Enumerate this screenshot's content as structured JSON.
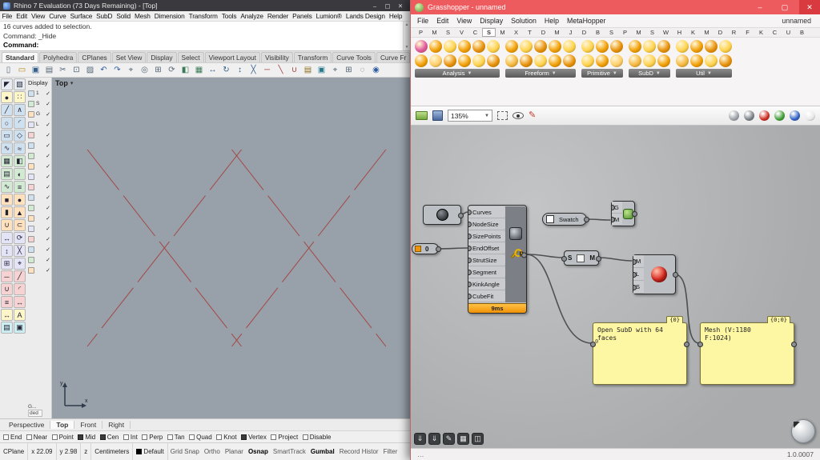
{
  "rhino": {
    "titlebar": {
      "title": "Rhino 7 Evaluation (73 Days Remaining) - [Top]"
    },
    "menu": [
      "File",
      "Edit",
      "View",
      "Curve",
      "Surface",
      "SubD",
      "Solid",
      "Mesh",
      "Dimension",
      "Transform",
      "Tools",
      "Analyze",
      "Render",
      "Panels",
      "Lumion®",
      "Lands Design",
      "Help"
    ],
    "command_history": [
      "16 curves added to selection.",
      "Command: _Hide"
    ],
    "command_prompt": "Command:",
    "toolbar_tabs": [
      {
        "label": "Standard",
        "selected": true
      },
      {
        "label": "Polyhedra"
      },
      {
        "label": "CPlanes"
      },
      {
        "label": "Set View"
      },
      {
        "label": "Display"
      },
      {
        "label": "Select"
      },
      {
        "label": "Viewport Layout"
      },
      {
        "label": "Visibility"
      },
      {
        "label": "Transform"
      },
      {
        "label": "Curve Tools"
      },
      {
        "label": "Curve Fr"
      }
    ],
    "toolbar_icons": [
      {
        "name": "new-file-icon",
        "g": "▯",
        "c": "#5a6a7a"
      },
      {
        "name": "open-file-icon",
        "g": "▭",
        "c": "#b8860b"
      },
      {
        "name": "save-icon",
        "g": "▣",
        "c": "#35608c"
      },
      {
        "name": "print-icon",
        "g": "▤",
        "c": "#556677"
      },
      {
        "name": "cut-icon",
        "g": "✂",
        "c": "#556677"
      },
      {
        "name": "copy-icon",
        "g": "⊡",
        "c": "#556677"
      },
      {
        "name": "paste-icon",
        "g": "▨",
        "c": "#556677"
      },
      {
        "name": "undo-icon",
        "g": "↶",
        "c": "#2e5c9e"
      },
      {
        "name": "redo-icon",
        "g": "↷",
        "c": "#2e5c9e"
      },
      {
        "name": "pan-icon",
        "g": "⌖",
        "c": "#556677"
      },
      {
        "name": "zoom-extents-icon",
        "g": "◎",
        "c": "#556677"
      },
      {
        "name": "zoom-window-icon",
        "g": "⊞",
        "c": "#556677"
      },
      {
        "name": "rotate-view-icon",
        "g": "⟳",
        "c": "#556677"
      },
      {
        "name": "shaded-view-icon",
        "g": "◧",
        "c": "#3b7a57"
      },
      {
        "name": "wireframe-view-icon",
        "g": "▦",
        "c": "#3b7a57"
      },
      {
        "name": "move-icon",
        "g": "↔",
        "c": "#35608c"
      },
      {
        "name": "rotate-icon",
        "g": "↻",
        "c": "#35608c"
      },
      {
        "name": "scale-icon",
        "g": "↕",
        "c": "#35608c"
      },
      {
        "name": "mirror-icon",
        "g": "╳",
        "c": "#35608c"
      },
      {
        "name": "trim-icon",
        "g": "─",
        "c": "#a23b3b"
      },
      {
        "name": "split-icon",
        "g": "╲",
        "c": "#a23b3b"
      },
      {
        "name": "join-icon",
        "g": "∪",
        "c": "#a23b3b"
      },
      {
        "name": "layers-icon",
        "g": "▤",
        "c": "#8a6d1a"
      },
      {
        "name": "properties-icon",
        "g": "▣",
        "c": "#2a7a8c"
      },
      {
        "name": "osnap-icon",
        "g": "⌖",
        "c": "#556677"
      },
      {
        "name": "grid-icon",
        "g": "⊞",
        "c": "#556677"
      },
      {
        "name": "hide-icon",
        "g": "◌",
        "c": "#556677"
      },
      {
        "name": "help-icon",
        "g": "◉",
        "c": "#2e5c9e"
      }
    ],
    "sidebar_icons": [
      {
        "name": "select-arrow-icon",
        "g": "◤",
        "c": "#e6ecf2"
      },
      {
        "name": "select-brush-icon",
        "g": "▧",
        "c": "#e6ecf2"
      },
      {
        "name": "point-icon",
        "g": "●",
        "c": "#fdf6c9"
      },
      {
        "name": "point-grid-icon",
        "g": "∷",
        "c": "#fdf6c9"
      },
      {
        "name": "line-icon",
        "g": "╱",
        "c": "#cfe0ef"
      },
      {
        "name": "polyline-icon",
        "g": "∧",
        "c": "#cfe0ef"
      },
      {
        "name": "circle-icon",
        "g": "○",
        "c": "#cfe0ef"
      },
      {
        "name": "arc-icon",
        "g": "◜",
        "c": "#cfe0ef"
      },
      {
        "name": "rectangle-icon",
        "g": "▭",
        "c": "#cfe0ef"
      },
      {
        "name": "polygon-icon",
        "g": "◇",
        "c": "#cfe0ef"
      },
      {
        "name": "freeform-curve-icon",
        "g": "∿",
        "c": "#cfe0ef"
      },
      {
        "name": "interpolate-curve-icon",
        "g": "≈",
        "c": "#cfe0ef"
      },
      {
        "name": "surface-plane-icon",
        "g": "▦",
        "c": "#d2ead2"
      },
      {
        "name": "surface-corner-icon",
        "g": "◧",
        "c": "#d2ead2"
      },
      {
        "name": "extrude-icon",
        "g": "▤",
        "c": "#d2ead2"
      },
      {
        "name": "revolve-icon",
        "g": "◐",
        "c": "#d2ead2"
      },
      {
        "name": "sweep-icon",
        "g": "∿",
        "c": "#d2ead2"
      },
      {
        "name": "loft-icon",
        "g": "≡",
        "c": "#d2ead2"
      },
      {
        "name": "box-icon",
        "g": "■",
        "c": "#ffe2bd"
      },
      {
        "name": "sphere-icon",
        "g": "●",
        "c": "#ffe2bd"
      },
      {
        "name": "cylinder-icon",
        "g": "▮",
        "c": "#ffe2bd"
      },
      {
        "name": "cone-icon",
        "g": "▲",
        "c": "#ffe2bd"
      },
      {
        "name": "boolean-union-icon",
        "g": "∪",
        "c": "#ffe2bd"
      },
      {
        "name": "boolean-difference-icon",
        "g": "⊂",
        "c": "#ffe2bd"
      },
      {
        "name": "move-tool-icon",
        "g": "↔",
        "c": "#e4e4f7"
      },
      {
        "name": "rotate-tool-icon",
        "g": "⟳",
        "c": "#e4e4f7"
      },
      {
        "name": "scale-tool-icon",
        "g": "↕",
        "c": "#e4e4f7"
      },
      {
        "name": "mirror-tool-icon",
        "g": "╳",
        "c": "#e4e4f7"
      },
      {
        "name": "array-icon",
        "g": "⊞",
        "c": "#e4e4f7"
      },
      {
        "name": "orient-icon",
        "g": "⌖",
        "c": "#e4e4f7"
      },
      {
        "name": "trim-tool-icon",
        "g": "─",
        "c": "#f7d2d2"
      },
      {
        "name": "split-tool-icon",
        "g": "╱",
        "c": "#f7d2d2"
      },
      {
        "name": "join-tool-icon",
        "g": "∪",
        "c": "#f7d2d2"
      },
      {
        "name": "fillet-icon",
        "g": "◜",
        "c": "#f7d2d2"
      },
      {
        "name": "offset-icon",
        "g": "≡",
        "c": "#f7d2d2"
      },
      {
        "name": "extend-icon",
        "g": "↔",
        "c": "#f7d2d2"
      },
      {
        "name": "dimension-icon",
        "g": "↔",
        "c": "#fdf6c9"
      },
      {
        "name": "text-icon",
        "g": "A",
        "c": "#fdf6c9"
      },
      {
        "name": "layer-icon",
        "g": "▤",
        "c": "#cdeef2"
      },
      {
        "name": "properties-panel-icon",
        "g": "▣",
        "c": "#cdeef2"
      }
    ],
    "display_panel": {
      "title": "Display",
      "rows": [
        {
          "label": "1",
          "checked": true,
          "c": "#cfe0ef"
        },
        {
          "label": "S",
          "checked": true,
          "c": "#d2ead2"
        },
        {
          "label": "G",
          "checked": true,
          "c": "#ffe2bd"
        },
        {
          "label": "L",
          "checked": true,
          "c": "#e4e4f7"
        },
        {
          "label": "",
          "checked": true,
          "c": "#f7d2d2"
        },
        {
          "label": "",
          "checked": true,
          "c": "#cfe0ef"
        },
        {
          "label": "",
          "checked": true,
          "c": "#d2ead2"
        },
        {
          "label": "",
          "checked": true,
          "c": "#ffe2bd"
        },
        {
          "label": "",
          "checked": true,
          "c": "#e4e4f7"
        },
        {
          "label": "",
          "checked": true,
          "c": "#f7d2d2"
        },
        {
          "label": "",
          "checked": true,
          "c": "#cfe0ef"
        },
        {
          "label": "",
          "checked": true,
          "c": "#d2ead2"
        },
        {
          "label": "",
          "checked": true,
          "c": "#ffe2bd"
        },
        {
          "label": "",
          "checked": true,
          "c": "#e4e4f7"
        },
        {
          "label": "",
          "checked": true,
          "c": "#f7d2d2"
        },
        {
          "label": "",
          "checked": true,
          "c": "#cfe0ef"
        },
        {
          "label": "",
          "checked": true,
          "c": "#d2ead2"
        },
        {
          "label": "",
          "checked": true,
          "c": "#ffe2bd"
        }
      ],
      "fragment1": "G...",
      "fragment2": "ded"
    },
    "viewport": {
      "label": "Top",
      "axis_x": "x",
      "axis_y": "y"
    },
    "viewport_tabs": [
      {
        "label": "Perspective"
      },
      {
        "label": "Top",
        "selected": true
      },
      {
        "label": "Front"
      },
      {
        "label": "Right"
      }
    ],
    "osnap": [
      {
        "label": "End"
      },
      {
        "label": "Near"
      },
      {
        "label": "Point"
      },
      {
        "label": "Mid",
        "checked": true
      },
      {
        "label": "Cen",
        "checked": true
      },
      {
        "label": "Int"
      },
      {
        "label": "Perp"
      },
      {
        "label": "Tan"
      },
      {
        "label": "Quad"
      },
      {
        "label": "Knot"
      },
      {
        "label": "Vertex",
        "checked": true
      },
      {
        "label": "Project"
      },
      {
        "label": "Disable"
      }
    ],
    "status": {
      "cplane": "CPlane",
      "x": "x 22.09",
      "y": "y 2.98",
      "z": "z",
      "units": "Centimeters",
      "layer": "Default",
      "toggles": [
        {
          "label": "Grid Snap"
        },
        {
          "label": "Ortho"
        },
        {
          "label": "Planar"
        },
        {
          "label": "Osnap",
          "bold": true
        },
        {
          "label": "SmartTrack"
        },
        {
          "label": "Gumbal",
          "bold": true
        },
        {
          "label": "Record Histor"
        },
        {
          "label": "Filter"
        }
      ]
    }
  },
  "grasshopper": {
    "titlebar": {
      "title": "Grasshopper - unnamed"
    },
    "menu": [
      "File",
      "Edit",
      "View",
      "Display",
      "Solution",
      "Help",
      "MetaHopper"
    ],
    "doc_label": "unnamed",
    "tabs": [
      "P",
      "M",
      "S",
      "V",
      "C",
      {
        "label": "S",
        "selected": true
      },
      "M",
      "X",
      "T",
      "D",
      "M",
      "J",
      "D",
      "B",
      "S",
      "P",
      "M",
      "S",
      "W",
      "H",
      "K",
      "M",
      "D",
      "R",
      "F",
      "K",
      "C",
      "U",
      "B"
    ],
    "ribbon": {
      "analysis": {
        "label": "Analysis",
        "icons": [
          {
            "c": "#e059a0"
          },
          {
            "c": "#f2a007"
          },
          {
            "c": "#ffd34d"
          },
          {
            "c": "#f2a007"
          },
          {
            "c": "#e8920c"
          },
          {
            "c": "#ffd34d"
          },
          {
            "c": "#f2a007"
          },
          {
            "c": "#ffcf6b"
          },
          {
            "c": "#e8920c"
          },
          {
            "c": "#f2a007"
          },
          {
            "c": "#ffd34d"
          },
          {
            "c": "#e8920c"
          }
        ]
      },
      "freeform": {
        "label": "Freeform",
        "icons": [
          {
            "c": "#f2a007"
          },
          {
            "c": "#ffd34d"
          },
          {
            "c": "#e8920c"
          },
          {
            "c": "#f2a007"
          },
          {
            "c": "#ffd34d"
          },
          {
            "c": "#f5b942"
          },
          {
            "c": "#e8920c"
          },
          {
            "c": "#ffd34d"
          },
          {
            "c": "#f2a007"
          },
          {
            "c": "#e8920c"
          }
        ]
      },
      "primitive": {
        "label": "Primitive",
        "icons": [
          {
            "c": "#ffd34d"
          },
          {
            "c": "#f2a007"
          },
          {
            "c": "#e8920c"
          },
          {
            "c": "#ffd34d"
          },
          {
            "c": "#f2a007"
          },
          {
            "c": "#ffcf6b"
          }
        ]
      },
      "subd": {
        "label": "SubD",
        "icons": [
          {
            "c": "#f2a007"
          },
          {
            "c": "#ffd34d"
          },
          {
            "c": "#e8920c"
          },
          {
            "c": "#f5b942"
          },
          {
            "c": "#ffd34d"
          },
          {
            "c": "#f2a007"
          }
        ]
      },
      "util": {
        "label": "Util",
        "icons": [
          {
            "c": "#ffd34d"
          },
          {
            "c": "#f2a007"
          },
          {
            "c": "#e8920c"
          },
          {
            "c": "#ffd34d"
          },
          {
            "c": "#f5b942"
          },
          {
            "c": "#f2a007"
          },
          {
            "c": "#ffd34d"
          },
          {
            "c": "#e8920c"
          }
        ]
      }
    },
    "canvas_toolbar": {
      "zoom": "135%"
    },
    "display_balls": [
      {
        "c": "#9aa0a6"
      },
      {
        "c": "#7a8086"
      },
      {
        "c": "#cc2b1e"
      },
      {
        "c": "#3f9b35"
      },
      {
        "c": "#2f5fc4"
      },
      {
        "c": "#e8e8e8"
      }
    ],
    "nodes": {
      "slider": {
        "value": "0"
      },
      "comp": {
        "input_list": [
          "Curves",
          "NodeSize",
          "SizePoints",
          "EndOffset",
          "StrutSize",
          "Segment",
          "KinkAngle",
          "CubeFit"
        ],
        "output": "P",
        "time": "9ms"
      },
      "swatch": {
        "label": "Swatch"
      },
      "gm": {
        "input_list": [
          "G",
          "M"
        ]
      },
      "sm": {
        "left": "S",
        "right": "M"
      },
      "mls": {
        "input_list": [
          "M",
          "L",
          "S"
        ]
      },
      "panel1": {
        "tag": "{0}",
        "index": "0",
        "text": "Open SubD with 64\nfaces"
      },
      "panel2": {
        "tag": "{0;0}",
        "text": "Mesh (V:1180\nF:1024)"
      }
    },
    "status_left": "…",
    "version": "1.0.0007"
  }
}
